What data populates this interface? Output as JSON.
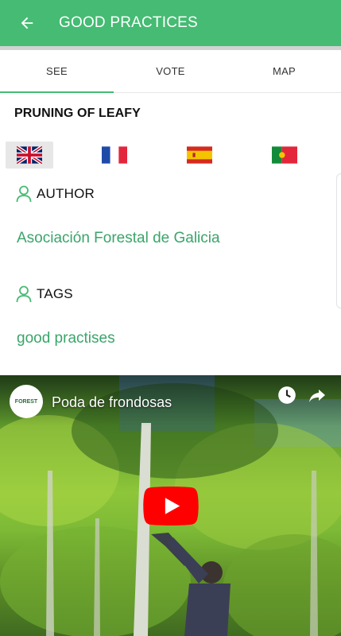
{
  "appbar": {
    "title": "GOOD PRACTICES",
    "back_icon": "arrow-left-icon",
    "color": "#45bb73"
  },
  "tabs": [
    {
      "label": "SEE",
      "active": true
    },
    {
      "label": "VOTE",
      "active": false
    },
    {
      "label": "MAP",
      "active": false
    }
  ],
  "practice": {
    "title": "PRUNING OF LEAFY"
  },
  "languages": [
    {
      "name": "english-flag-icon",
      "selected": true
    },
    {
      "name": "french-flag-icon",
      "selected": false
    },
    {
      "name": "spanish-flag-icon",
      "selected": false
    },
    {
      "name": "portuguese-flag-icon",
      "selected": false
    }
  ],
  "author": {
    "label": "AUTHOR",
    "value": "Asociación Forestal de Galicia",
    "icon": "person-icon"
  },
  "tags": {
    "label": "TAGS",
    "value": "good practises",
    "icon": "person-icon"
  },
  "video": {
    "title": "Poda de frondosas",
    "channel_logo_text": "FOREST",
    "icons": [
      "watch-later-icon",
      "share-icon",
      "play-icon"
    ]
  },
  "colors": {
    "accent": "#45bb73",
    "link_green": "#3aa56a",
    "youtube_red": "#ff0000"
  }
}
